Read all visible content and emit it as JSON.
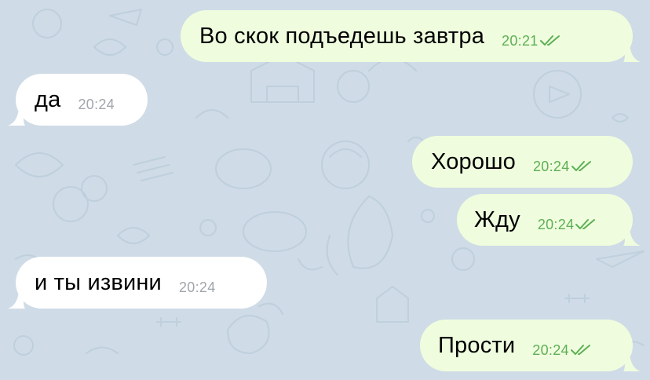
{
  "chat": {
    "messages": [
      {
        "direction": "outgoing",
        "text": "Во скок подъедешь завтра",
        "time": "20:21",
        "status": "read"
      },
      {
        "direction": "incoming",
        "text": "да",
        "time": "20:24"
      },
      {
        "direction": "outgoing",
        "text": "Хорошо",
        "time": "20:24",
        "status": "read"
      },
      {
        "direction": "outgoing",
        "text": "Жду",
        "time": "20:24",
        "status": "read"
      },
      {
        "direction": "incoming",
        "text": "и ты извини",
        "time": "20:24"
      },
      {
        "direction": "outgoing",
        "text": "Прости",
        "time": "20:24",
        "status": "read"
      }
    ]
  },
  "colors": {
    "wallpaper": "#cfdbe6",
    "wallpaper_doodle": "#bccddc",
    "outgoing_bubble": "#effdde",
    "incoming_bubble": "#ffffff",
    "outgoing_time": "#5daf54",
    "incoming_time": "#a0a6ac",
    "read_check": "#5daf54"
  },
  "icons": {
    "read_status": "double-check-icon",
    "wallpaper": "doodle-pattern"
  }
}
